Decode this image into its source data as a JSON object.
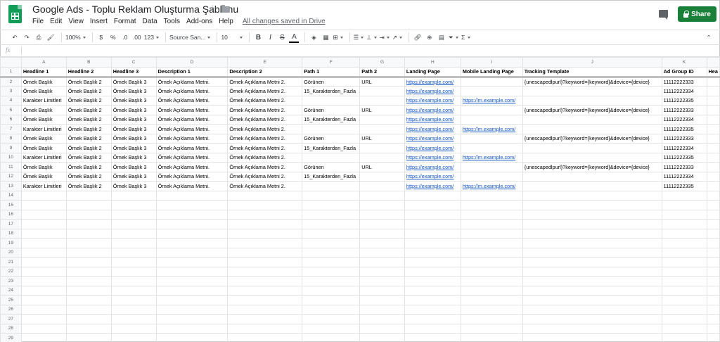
{
  "doc": {
    "title": "Google Ads - Toplu Reklam Oluşturma Şablonu",
    "save_status": "All changes saved in Drive",
    "share_label": "Share"
  },
  "menu": [
    "File",
    "Edit",
    "View",
    "Insert",
    "Format",
    "Data",
    "Tools",
    "Add-ons",
    "Help"
  ],
  "toolbar": {
    "zoom": "100%",
    "currency": "$",
    "percent": "%",
    "decrease_decimal": ".0",
    "increase_decimal": ".00",
    "more_formats": "123",
    "font": "Source San...",
    "font_size": "10",
    "bold": "B",
    "italic": "I",
    "strike": "S",
    "text_color": "A",
    "functions": "Σ"
  },
  "formula_bar": {
    "fx": "fx",
    "value": ""
  },
  "columns": [
    "A",
    "B",
    "C",
    "D",
    "E",
    "F",
    "G",
    "H",
    "I",
    "J",
    "K",
    ""
  ],
  "rows": [
    [
      "Headline 1",
      "Headline 2",
      "Headline 3",
      "Description 1",
      "Description 2",
      "Path 1",
      "Path 2",
      "Landing Page",
      "Mobile Landing Page",
      "Tracking Template",
      "Ad Group ID",
      "Hea"
    ],
    [
      "Örnek Başlık",
      "Örnek Başlık 2",
      "Örnek Başlık 3",
      "Örnek Açıklama Metni.",
      "Örnek Açıklama Metni 2.",
      "Görünen",
      "URL",
      "https://example.com/",
      "",
      "{unescapedlpurl}?keyword={keyword}&device={device}",
      "11112222333",
      ""
    ],
    [
      "Örnek Başlık",
      "Örnek Başlık 2",
      "Örnek Başlık 3",
      "Örnek Açıklama Metni.",
      "Örnek Açıklama Metni 2.",
      "15_Karakterden_Fazla",
      "",
      "https://example.com/",
      "",
      "",
      "11112222334",
      ""
    ],
    [
      "Karakter Limitleri",
      "Örnek Başlık 2",
      "Örnek Başlık 3",
      "Örnek Açıklama Metni.",
      "Örnek Açıklama Metni 2.",
      "",
      "",
      "https://example.com/",
      "https://m.example.com/",
      "",
      "11112222335",
      ""
    ],
    [
      "Örnek Başlık",
      "Örnek Başlık 2",
      "Örnek Başlık 3",
      "Örnek Açıklama Metni.",
      "Örnek Açıklama Metni 2.",
      "Görünen",
      "URL",
      "https://example.com/",
      "",
      "{unescapedlpurl}?keyword={keyword}&device={device}",
      "11112222333",
      ""
    ],
    [
      "Örnek Başlık",
      "Örnek Başlık 2",
      "Örnek Başlık 3",
      "Örnek Açıklama Metni.",
      "Örnek Açıklama Metni 2.",
      "15_Karakterden_Fazla",
      "",
      "https://example.com/",
      "",
      "",
      "11112222334",
      ""
    ],
    [
      "Karakter Limitleri",
      "Örnek Başlık 2",
      "Örnek Başlık 3",
      "Örnek Açıklama Metni.",
      "Örnek Açıklama Metni 2.",
      "",
      "",
      "https://example.com/",
      "https://m.example.com/",
      "",
      "11112222335",
      ""
    ],
    [
      "Örnek Başlık",
      "Örnek Başlık 2",
      "Örnek Başlık 3",
      "Örnek Açıklama Metni.",
      "Örnek Açıklama Metni 2.",
      "Görünen",
      "URL",
      "https://example.com/",
      "",
      "{unescapedlpurl}?keyword={keyword}&device={device}",
      "11112222333",
      ""
    ],
    [
      "Örnek Başlık",
      "Örnek Başlık 2",
      "Örnek Başlık 3",
      "Örnek Açıklama Metni.",
      "Örnek Açıklama Metni 2.",
      "15_Karakterden_Fazla",
      "",
      "https://example.com/",
      "",
      "",
      "11112222334",
      ""
    ],
    [
      "Karakter Limitleri",
      "Örnek Başlık 2",
      "Örnek Başlık 3",
      "Örnek Açıklama Metni.",
      "Örnek Açıklama Metni 2.",
      "",
      "",
      "https://example.com/",
      "https://m.example.com/",
      "",
      "11112222335",
      ""
    ],
    [
      "Örnek Başlık",
      "Örnek Başlık 2",
      "Örnek Başlık 3",
      "Örnek Açıklama Metni.",
      "Örnek Açıklama Metni 2.",
      "Görünen",
      "URL",
      "https://example.com/",
      "",
      "{unescapedlpurl}?keyword={keyword}&device={device}",
      "11112222333",
      ""
    ],
    [
      "Örnek Başlık",
      "Örnek Başlık 2",
      "Örnek Başlık 3",
      "Örnek Açıklama Metni.",
      "Örnek Açıklama Metni 2.",
      "15_Karakterden_Fazla",
      "",
      "https://example.com/",
      "",
      "",
      "11112222334",
      ""
    ],
    [
      "Karakter Limitleri",
      "Örnek Başlık 2",
      "Örnek Başlık 3",
      "Örnek Açıklama Metni.",
      "Örnek Açıklama Metni 2.",
      "",
      "",
      "https://example.com/",
      "https://m.example.com/",
      "",
      "11112222335",
      ""
    ]
  ],
  "total_rows": 29,
  "link_columns": [
    7,
    8
  ],
  "colors": {
    "share": "#188038",
    "link": "#1155cc",
    "sheets_green": "#0f9d58"
  }
}
